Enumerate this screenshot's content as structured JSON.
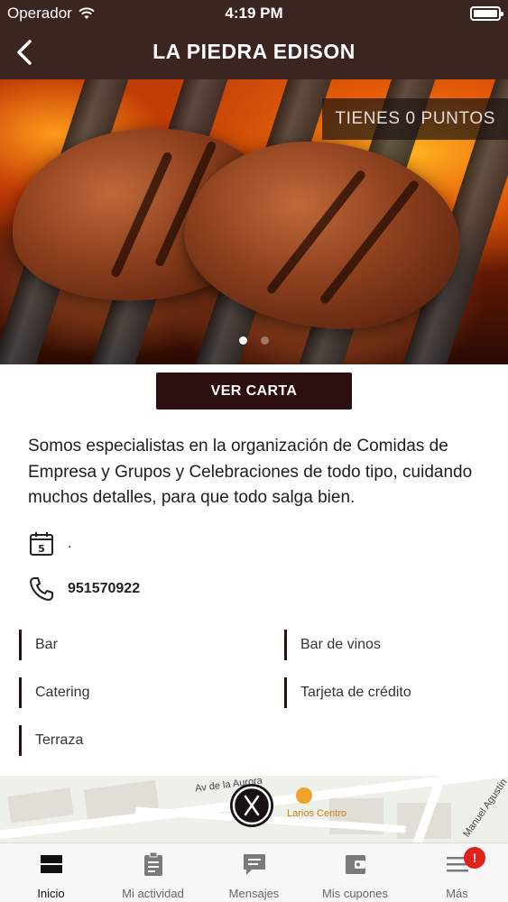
{
  "statusbar": {
    "carrier": "Operador",
    "time": "4:19 PM"
  },
  "header": {
    "title": "LA PIEDRA EDISON"
  },
  "hero": {
    "points_label": "TIENES 0 PUNTOS",
    "slide_count": 2,
    "active_slide": 1
  },
  "menu_button": {
    "label": "VER CARTA"
  },
  "description": "Somos especialistas en la organización de Comidas de Empresa y Grupos y Celebraciones de todo tipo, cuidando muchos detalles, para que todo salga bien.",
  "schedule": {
    "value": "."
  },
  "phone": {
    "number": "951570922"
  },
  "features": [
    "Bar",
    "Bar de vinos",
    "Catering",
    "Tarjeta de crédito",
    "Terraza"
  ],
  "map": {
    "street1": "Av de la Aurora",
    "poi": "Larios Centro",
    "street2": "Manuel Agustín"
  },
  "tabs": [
    {
      "label": "Inicio",
      "icon": "home-icon",
      "active": true
    },
    {
      "label": "Mi actividad",
      "icon": "clipboard-icon",
      "active": false
    },
    {
      "label": "Mensajes",
      "icon": "message-icon",
      "active": false
    },
    {
      "label": "Mis cupones",
      "icon": "wallet-icon",
      "active": false
    },
    {
      "label": "Más",
      "icon": "menu-icon",
      "active": false,
      "badge": "!"
    }
  ],
  "colors": {
    "header_bg": "#3b2520",
    "button_bg": "#2d0f0f",
    "badge": "#e3211b"
  }
}
